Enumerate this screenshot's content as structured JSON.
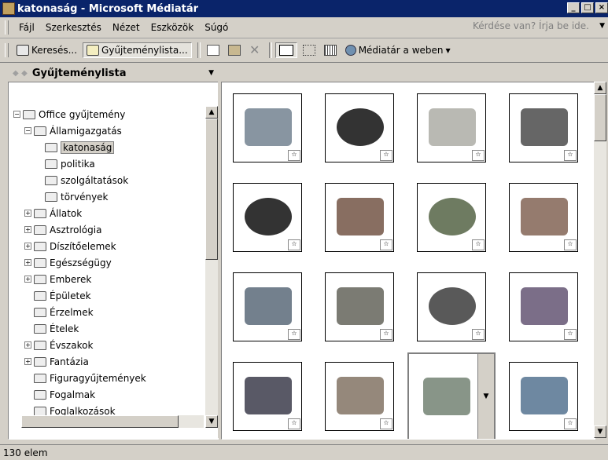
{
  "window": {
    "title": "katonaság - Microsoft Médiatár",
    "buttons": [
      "_",
      "□",
      "×"
    ]
  },
  "menu": {
    "items": [
      {
        "label": "Fájl",
        "icon": null
      },
      {
        "label": "Szerkesztés",
        "icon": null
      },
      {
        "label": "Nézet",
        "icon": null
      },
      {
        "label": "Eszközök",
        "icon": null
      },
      {
        "label": "Súgó",
        "icon": null
      }
    ],
    "help_placeholder": "Kérdése van? Írja be ide."
  },
  "toolbar": {
    "search_label": "Keresés...",
    "collection_list_label": "Gyűjteménylista...",
    "web_label": "Médiatár a weben"
  },
  "panel": {
    "title": "Gyűjteménylista",
    "tree": [
      {
        "label": "Office gyűjtemény",
        "level": 0,
        "exp": "−"
      },
      {
        "label": "Államigazgatás",
        "level": 1,
        "exp": "−"
      },
      {
        "label": "katonaság",
        "level": 2,
        "exp": "",
        "selected": true
      },
      {
        "label": "politika",
        "level": 2,
        "exp": ""
      },
      {
        "label": "szolgáltatások",
        "level": 2,
        "exp": ""
      },
      {
        "label": "törvények",
        "level": 2,
        "exp": ""
      },
      {
        "label": "Állatok",
        "level": 1,
        "exp": "+"
      },
      {
        "label": "Asztrológia",
        "level": 1,
        "exp": "+"
      },
      {
        "label": "Díszítőelemek",
        "level": 1,
        "exp": "+"
      },
      {
        "label": "Egészségügy",
        "level": 1,
        "exp": "+"
      },
      {
        "label": "Emberek",
        "level": 1,
        "exp": "+"
      },
      {
        "label": "Épületek",
        "level": 1,
        "exp": ""
      },
      {
        "label": "Érzelmek",
        "level": 1,
        "exp": ""
      },
      {
        "label": "Ételek",
        "level": 1,
        "exp": ""
      },
      {
        "label": "Évszakok",
        "level": 1,
        "exp": "+"
      },
      {
        "label": "Fantázia",
        "level": 1,
        "exp": "+"
      },
      {
        "label": "Figuragyűjtemények",
        "level": 1,
        "exp": ""
      },
      {
        "label": "Fogalmak",
        "level": 1,
        "exp": ""
      },
      {
        "label": "Foglalkozások",
        "level": 1,
        "exp": ""
      }
    ]
  },
  "gallery": {
    "items": [
      {
        "icon": "fighter-jet-icon",
        "color": "#6a7a8a"
      },
      {
        "icon": "bomb-icon",
        "color": "#000000"
      },
      {
        "icon": "sand-texture-icon",
        "color": "#a8a8a0"
      },
      {
        "icon": "rocket-face-icon",
        "color": "#404040"
      },
      {
        "icon": "cartoon-bomb-icon",
        "color": "#000000"
      },
      {
        "icon": "small-figures-icon",
        "color": "#6a4a3a"
      },
      {
        "icon": "grenade-icon",
        "color": "#4a5a3a"
      },
      {
        "icon": "soldier-binoculars-icon",
        "color": "#7a5a4a"
      },
      {
        "icon": "helmet-face-icon",
        "color": "#506070"
      },
      {
        "icon": "saluting-soldier-icon",
        "color": "#5a5a50"
      },
      {
        "icon": "falling-bomb-icon",
        "color": "#303030"
      },
      {
        "icon": "jet-formation-icon",
        "color": "#5a4a6a"
      },
      {
        "icon": "stealth-jet-icon",
        "color": "#303040"
      },
      {
        "icon": "submarine-icon",
        "color": "#7a6a5a"
      },
      {
        "icon": "helicopter-icon",
        "color": "#6a7a6a"
      },
      {
        "icon": "battleship-icon",
        "color": "#4a6a8a"
      }
    ]
  },
  "status": {
    "text": "130 elem"
  }
}
